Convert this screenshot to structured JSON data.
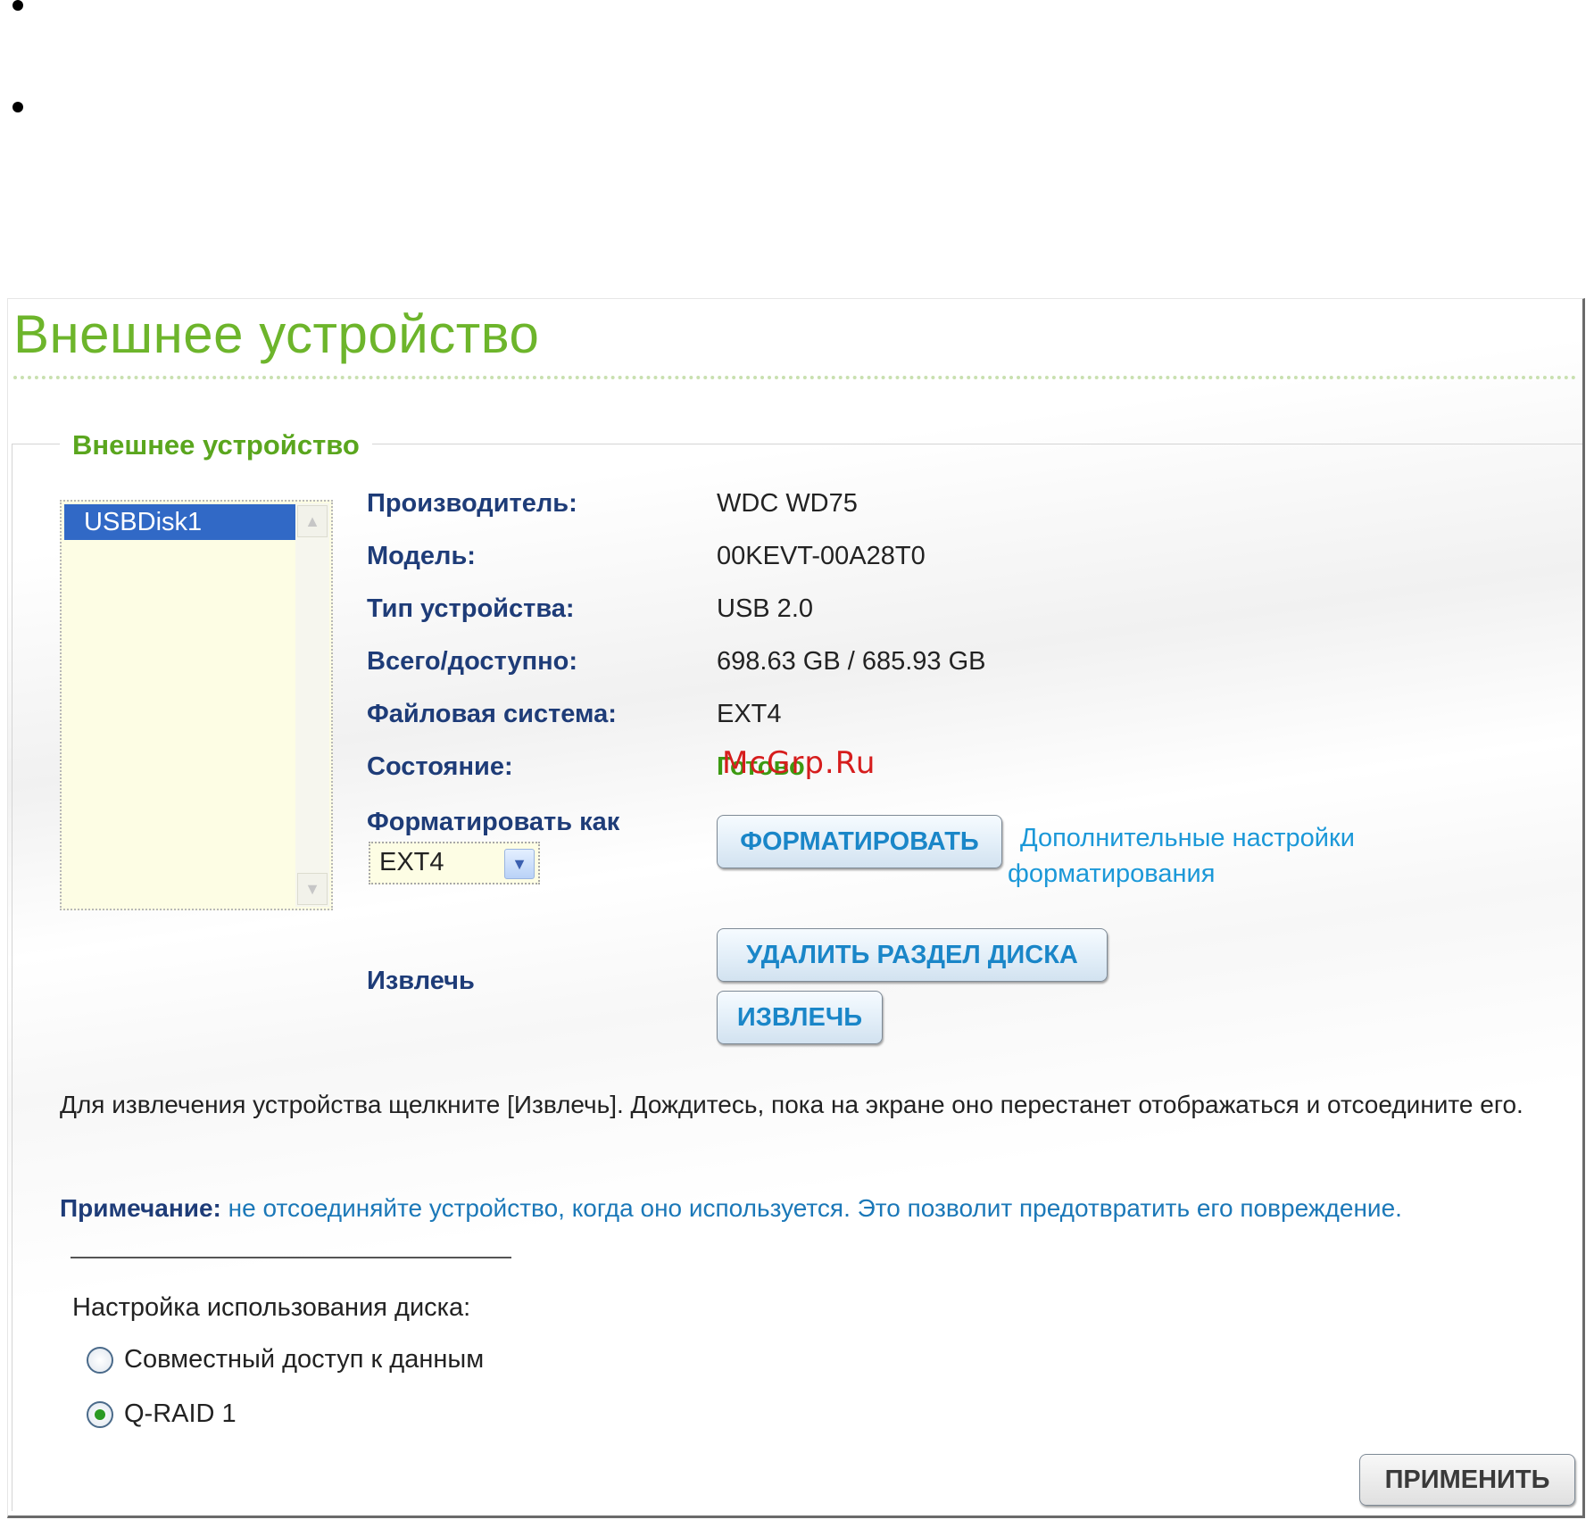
{
  "page_title": "Внешнее устройство",
  "group_title": "Внешнее устройство",
  "device_list": {
    "items": [
      "USBDisk1"
    ],
    "selected_index": 0
  },
  "fields": [
    {
      "label": "Производитель:",
      "value": "WDC WD75"
    },
    {
      "label": "Модель:",
      "value": "00KEVT-00A28T0"
    },
    {
      "label": "Тип устройства:",
      "value": "USB 2.0"
    },
    {
      "label": "Всего/доступно:",
      "value": "698.63 GB / 685.93 GB"
    },
    {
      "label": "Файловая система:",
      "value": "EXT4"
    },
    {
      "label": "Состояние:",
      "value": "Готово"
    }
  ],
  "watermark": "McGrp.Ru",
  "format": {
    "label": "Форматировать как",
    "selected": "EXT4",
    "button": "ФОРМАТИРОВАТЬ",
    "advanced_link_line1": "Дополнительные настройки",
    "advanced_link_line2": "форматирования"
  },
  "eject": {
    "label": "Извлечь",
    "delete_partition_button": "УДАЛИТЬ РАЗДЕЛ ДИСКА",
    "eject_button": "ИЗВЛЕЧЬ"
  },
  "info_text": "Для извлечения устройства щелкните [Извлечь]. Дождитесь, пока на экране оно перестанет отображаться и отсоедините его.",
  "note": {
    "prefix": "Примечание:",
    "text": " не отсоединяйте устройство, когда оно используется. Это позволит предотвратить его повреждение."
  },
  "disk_usage": {
    "title": "Настройка использования диска:",
    "options": [
      {
        "label": "Совместный доступ к данным",
        "checked": false
      },
      {
        "label": "Q-RAID 1",
        "checked": true
      }
    ]
  },
  "apply_button": "ПРИМЕНИТЬ",
  "colors": {
    "title_green": "#6db52b",
    "label_navy": "#1e3c78",
    "button_text": "#1a86c8",
    "link_blue": "#1b98d8",
    "selection_blue": "#3169c6",
    "status_green": "#3c9a12",
    "watermark_red": "#d61d1d"
  }
}
